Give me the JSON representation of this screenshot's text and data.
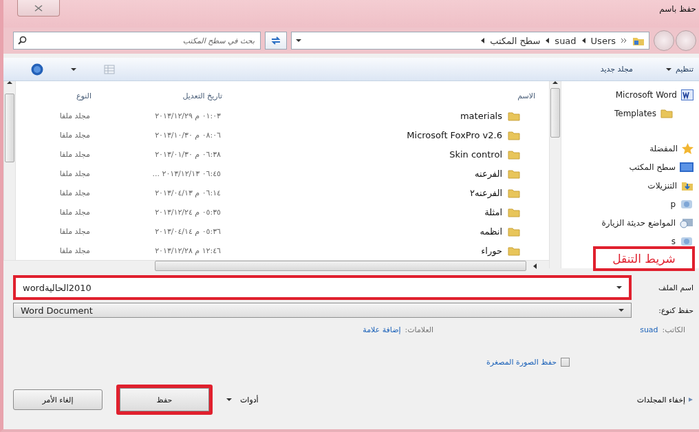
{
  "window": {
    "title": "حفظ باسم"
  },
  "address_bar": {
    "path": [
      "Users",
      "suad",
      "سطح المكتب"
    ]
  },
  "search": {
    "placeholder": "بحث في سطح المكتب"
  },
  "toolbar": {
    "buttons": [
      {
        "label": "تنظيم",
        "has_menu": true
      },
      {
        "label": "مجلد جديد",
        "has_menu": false
      }
    ]
  },
  "sidebar": {
    "items": [
      {
        "kind": "word",
        "label": "Microsoft Word"
      },
      {
        "kind": "folder",
        "label": "Templates"
      },
      {
        "kind": "star",
        "label": "المفضلة"
      },
      {
        "kind": "desktop",
        "label": "سطح المكتب"
      },
      {
        "kind": "downloads",
        "label": "التنزيلات"
      },
      {
        "kind": "place",
        "label": "p"
      },
      {
        "kind": "recent",
        "label": "المواضع حديثة الزيارة"
      },
      {
        "kind": "place",
        "label": "s"
      }
    ]
  },
  "file_list": {
    "columns": [
      "الاسم",
      "تاريخ التعديل",
      "النوع"
    ],
    "rows": [
      {
        "name": "materials",
        "modified": "٠١:٠٣ م ٢٠١٣/١٢/٢٩",
        "type": "مجلد ملفا"
      },
      {
        "name": "Microsoft FoxPro v2.6",
        "modified": "٠٨:٠٦ م ٢٠١٣/١٠/٣٠",
        "type": "مجلد ملفا"
      },
      {
        "name": "Skin control",
        "modified": "٠٦:٣٨ م ٢٠١٣/٠١/٣٠",
        "type": "مجلد ملفا"
      },
      {
        "name": "الفرعنه",
        "modified": "٠٦:٤٥ ٢٠١٣/١٢/١٣ ...",
        "type": "مجلد ملفا"
      },
      {
        "name": "الفرعنه٢",
        "modified": "٠٦:١٤ م ٢٠١٣/٠٤/١٣",
        "type": "مجلد ملفا"
      },
      {
        "name": "امثلة",
        "modified": "٠٥:٣٥ م ٢٠١٣/١٢/٢٤",
        "type": "مجلد ملفا"
      },
      {
        "name": "انظمه",
        "modified": "٠٥:٣٦ م ٢٠١٣/٠٤/١٤",
        "type": "مجلد ملفا"
      },
      {
        "name": "حوراء",
        "modified": "١٢:٤٦ م ٢٠١٣/١٢/٢٨",
        "type": "مجلد ملفا"
      }
    ]
  },
  "annotation": {
    "label": "شريط التنقل"
  },
  "form": {
    "file_name": {
      "label": "اسم الملف",
      "value": "2010الحاليةword",
      "highlighted": true
    },
    "save_as_type": {
      "label": "حفظ كنوع:",
      "value": "Word Document"
    },
    "authors": {
      "label": "الكاتب:",
      "value": "suad"
    },
    "tags": {
      "label": "العلامات:",
      "value": "إضافة علامة"
    },
    "thumbnail": {
      "label": "حفظ الصورة المصغرة",
      "checked": false
    }
  },
  "footer": {
    "hide_folders": "إخفاء المجلدات",
    "tools": "أدوات",
    "buttons": [
      {
        "label": "حفظ",
        "highlighted": true
      },
      {
        "label": "إلغاء الأمر",
        "highlighted": false
      }
    ]
  }
}
